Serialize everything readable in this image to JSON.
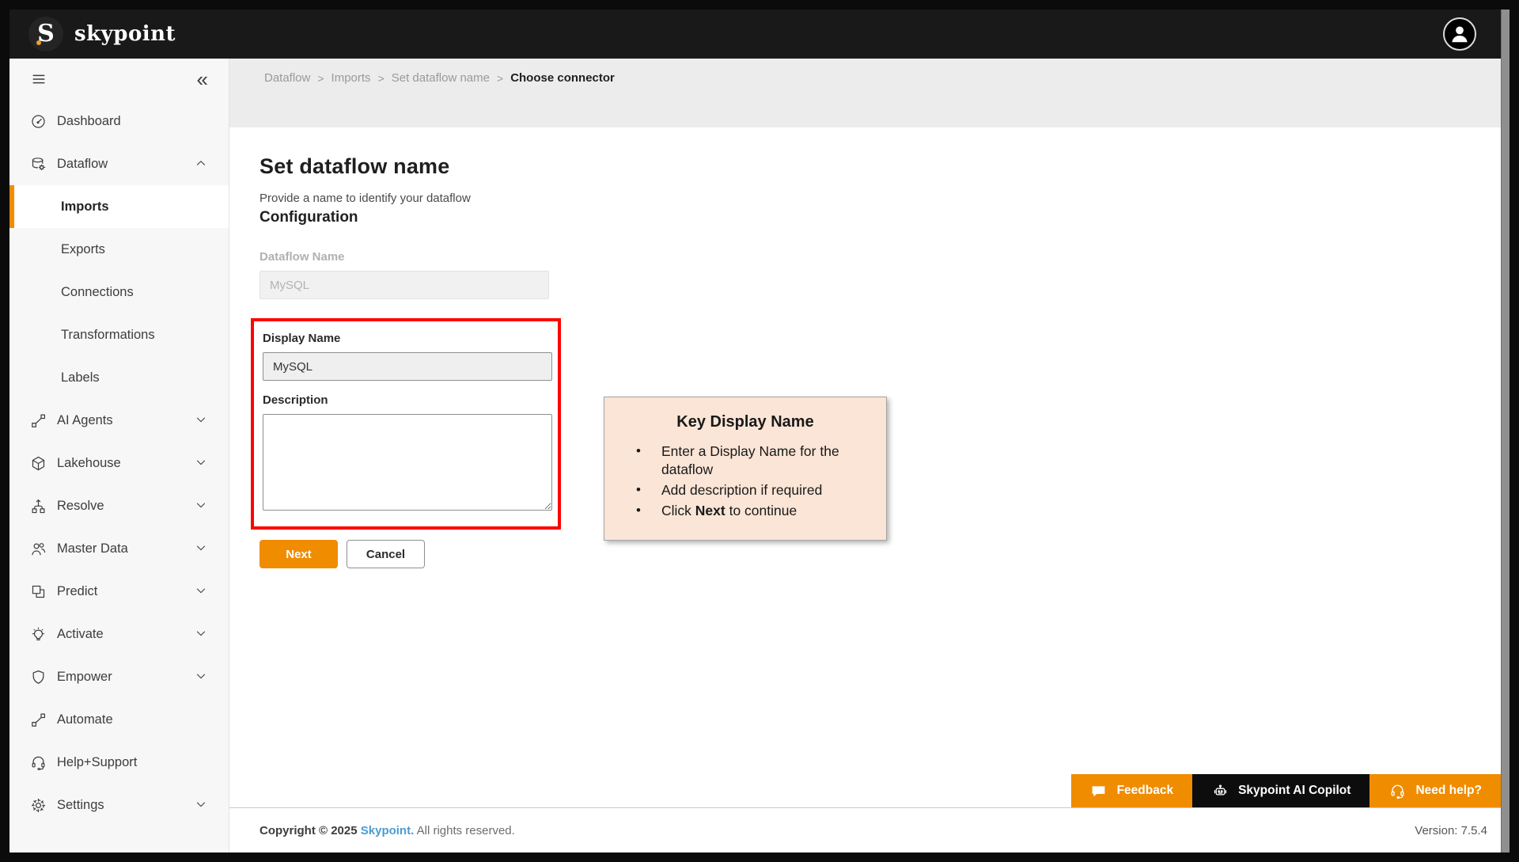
{
  "header": {
    "logo_letter": "S",
    "brand": "skypoint"
  },
  "sidebar": {
    "items": [
      {
        "id": "dashboard",
        "label": "Dashboard",
        "icon": "dashboard-icon",
        "chevron": null,
        "active": false,
        "sub": false
      },
      {
        "id": "dataflow",
        "label": "Dataflow",
        "icon": "dataflow-icon",
        "chevron": "up",
        "active": false,
        "sub": false
      },
      {
        "id": "imports",
        "label": "Imports",
        "icon": null,
        "chevron": null,
        "active": true,
        "sub": true
      },
      {
        "id": "exports",
        "label": "Exports",
        "icon": null,
        "chevron": null,
        "active": false,
        "sub": true
      },
      {
        "id": "connections",
        "label": "Connections",
        "icon": null,
        "chevron": null,
        "active": false,
        "sub": true
      },
      {
        "id": "transformations",
        "label": "Transformations",
        "icon": null,
        "chevron": null,
        "active": false,
        "sub": true
      },
      {
        "id": "labels",
        "label": "Labels",
        "icon": null,
        "chevron": null,
        "active": false,
        "sub": true
      },
      {
        "id": "ai-agents",
        "label": "AI Agents",
        "icon": "node-graph-icon",
        "chevron": "down",
        "active": false,
        "sub": false
      },
      {
        "id": "lakehouse",
        "label": "Lakehouse",
        "icon": "cube-icon",
        "chevron": "down",
        "active": false,
        "sub": false
      },
      {
        "id": "resolve",
        "label": "Resolve",
        "icon": "hierarchy-icon",
        "chevron": "down",
        "active": false,
        "sub": false
      },
      {
        "id": "master-data",
        "label": "Master Data",
        "icon": "people-icon",
        "chevron": "down",
        "active": false,
        "sub": false
      },
      {
        "id": "predict",
        "label": "Predict",
        "icon": "squares-icon",
        "chevron": "down",
        "active": false,
        "sub": false
      },
      {
        "id": "activate",
        "label": "Activate",
        "icon": "lightbulb-icon",
        "chevron": "down",
        "active": false,
        "sub": false
      },
      {
        "id": "empower",
        "label": "Empower",
        "icon": "shield-icon",
        "chevron": "down",
        "active": false,
        "sub": false
      },
      {
        "id": "automate",
        "label": "Automate",
        "icon": "node-graph-icon",
        "chevron": null,
        "active": false,
        "sub": false
      },
      {
        "id": "help-support",
        "label": "Help+Support",
        "icon": "headset-icon",
        "chevron": null,
        "active": false,
        "sub": false
      },
      {
        "id": "settings",
        "label": "Settings",
        "icon": "gear-icon",
        "chevron": "down",
        "active": false,
        "sub": false
      }
    ]
  },
  "breadcrumb": {
    "separator": ">",
    "items": [
      "Dataflow",
      "Imports",
      "Set dataflow name"
    ],
    "current": "Choose connector"
  },
  "page": {
    "title": "Set dataflow name",
    "subtitle": "Provide a name to identify your dataflow",
    "section": "Configuration"
  },
  "form": {
    "dataflow_name": {
      "label": "Dataflow Name",
      "value": "MySQL",
      "disabled": true
    },
    "display_name": {
      "label": "Display Name",
      "value": "MySQL"
    },
    "description": {
      "label": "Description",
      "value": ""
    },
    "next_label": "Next",
    "cancel_label": "Cancel"
  },
  "callout": {
    "title": "Key Display Name",
    "bullets": [
      [
        {
          "t": "Enter a Display Name for the dataflow"
        }
      ],
      [
        {
          "t": "Add description if required"
        }
      ],
      [
        {
          "t": "Click "
        },
        {
          "t": "Next",
          "b": true
        },
        {
          "t": " to continue"
        }
      ]
    ]
  },
  "quick_actions": [
    {
      "id": "feedback",
      "label": "Feedback",
      "icon": "speech-bubble-icon",
      "style": "orange"
    },
    {
      "id": "copilot",
      "label": "Skypoint AI Copilot",
      "icon": "robot-icon",
      "style": "black"
    },
    {
      "id": "need-help",
      "label": "Need help?",
      "icon": "headset-icon",
      "style": "orange"
    }
  ],
  "footer": {
    "copyright_prefix": "Copyright © 2025 ",
    "brand_link": "Skypoint.",
    "copyright_suffix": " All rights reserved.",
    "version": "Version: 7.5.4"
  },
  "colors": {
    "accent_orange": "#f08c00",
    "header_bg": "#191919",
    "sidebar_bg": "#f7f7f7",
    "breadcrumb_band": "#ececec",
    "highlight_red": "#fe0101",
    "callout_bg": "#fbe5d6",
    "link_blue": "#4a9bd4"
  }
}
